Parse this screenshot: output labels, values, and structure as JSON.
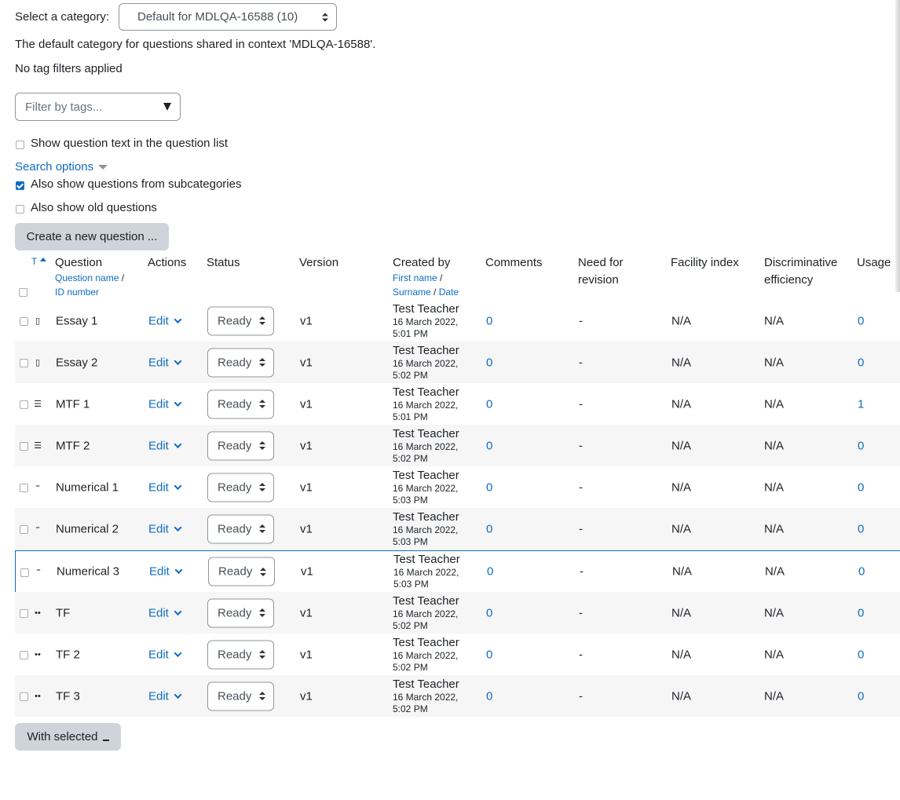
{
  "category": {
    "label": "Select a category:",
    "selected": "Default for MDLQA-16588 (10)",
    "description": "The default category for questions shared in context 'MDLQA-16588'."
  },
  "tags": {
    "status": "No tag filters applied",
    "placeholder": "Filter by tags..."
  },
  "options": {
    "show_text": "Show question text in the question list",
    "search_options": "Search options",
    "subcategories": "Also show questions from subcategories",
    "old_questions": "Also show old questions"
  },
  "buttons": {
    "create": "Create a new question ...",
    "with_selected": "With selected"
  },
  "table": {
    "headers": {
      "type": "T",
      "question": "Question",
      "question_name": "Question name",
      "slash": "/",
      "id_number": "ID number",
      "actions": "Actions",
      "status": "Status",
      "version": "Version",
      "created_by": "Created by",
      "first_name": "First name",
      "surname": "Surname",
      "date": "Date",
      "comments": "Comments",
      "need_for": "Need for",
      "revision": "revision",
      "facility": "Facility index",
      "discriminative": "Discriminative",
      "efficiency": "efficiency",
      "usage": "Usage"
    },
    "edit_label": "Edit",
    "rows": [
      {
        "icon": "essay-icon",
        "name": "Essay 1",
        "status": "Ready",
        "version": "v1",
        "creator": "Test Teacher",
        "date1": "16 March 2022,",
        "date2": "5:01 PM",
        "comments": "0",
        "revision": "-",
        "facility": "N/A",
        "discrim": "N/A",
        "usage": "0"
      },
      {
        "icon": "essay-icon",
        "name": "Essay 2",
        "status": "Ready",
        "version": "v1",
        "creator": "Test Teacher",
        "date1": "16 March 2022,",
        "date2": "5:02 PM",
        "comments": "0",
        "revision": "-",
        "facility": "N/A",
        "discrim": "N/A",
        "usage": "0"
      },
      {
        "icon": "list-icon",
        "name": "MTF 1",
        "status": "Ready",
        "version": "v1",
        "creator": "Test Teacher",
        "date1": "16 March 2022,",
        "date2": "5:01 PM",
        "comments": "0",
        "revision": "-",
        "facility": "N/A",
        "discrim": "N/A",
        "usage": "1"
      },
      {
        "icon": "list-icon",
        "name": "MTF 2",
        "status": "Ready",
        "version": "v1",
        "creator": "Test Teacher",
        "date1": "16 March 2022,",
        "date2": "5:02 PM",
        "comments": "0",
        "revision": "-",
        "facility": "N/A",
        "discrim": "N/A",
        "usage": "0"
      },
      {
        "icon": "numerical-icon",
        "name": "Numerical 1",
        "status": "Ready",
        "version": "v1",
        "creator": "Test Teacher",
        "date1": "16 March 2022,",
        "date2": "5:03 PM",
        "comments": "0",
        "revision": "-",
        "facility": "N/A",
        "discrim": "N/A",
        "usage": "0"
      },
      {
        "icon": "numerical-icon",
        "name": "Numerical 2",
        "status": "Ready",
        "version": "v1",
        "creator": "Test Teacher",
        "date1": "16 March 2022,",
        "date2": "5:03 PM",
        "comments": "0",
        "revision": "-",
        "facility": "N/A",
        "discrim": "N/A",
        "usage": "0"
      },
      {
        "icon": "numerical-icon",
        "name": "Numerical 3",
        "status": "Ready",
        "version": "v1",
        "creator": "Test Teacher",
        "date1": "16 March 2022,",
        "date2": "5:03 PM",
        "comments": "0",
        "revision": "-",
        "facility": "N/A",
        "discrim": "N/A",
        "usage": "0"
      },
      {
        "icon": "true-false-icon",
        "name": "TF",
        "status": "Ready",
        "version": "v1",
        "creator": "Test Teacher",
        "date1": "16 March 2022,",
        "date2": "5:02 PM",
        "comments": "0",
        "revision": "-",
        "facility": "N/A",
        "discrim": "N/A",
        "usage": "0"
      },
      {
        "icon": "true-false-icon",
        "name": "TF 2",
        "status": "Ready",
        "version": "v1",
        "creator": "Test Teacher",
        "date1": "16 March 2022,",
        "date2": "5:02 PM",
        "comments": "0",
        "revision": "-",
        "facility": "N/A",
        "discrim": "N/A",
        "usage": "0"
      },
      {
        "icon": "true-false-icon",
        "name": "TF 3",
        "status": "Ready",
        "version": "v1",
        "creator": "Test Teacher",
        "date1": "16 March 2022,",
        "date2": "5:02 PM",
        "comments": "0",
        "revision": "-",
        "facility": "N/A",
        "discrim": "N/A",
        "usage": "0"
      }
    ]
  }
}
